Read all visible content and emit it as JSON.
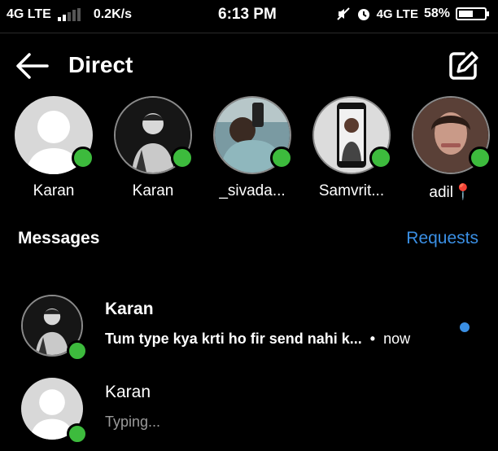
{
  "status_bar": {
    "network": "4G LTE",
    "speed": "0.2K/s",
    "time": "6:13 PM",
    "network_right": "4G LTE",
    "battery_percent": "58%",
    "battery_level": 0.58,
    "icons": [
      "signal-icon",
      "mute-icon",
      "alarm-icon",
      "battery-icon"
    ]
  },
  "header": {
    "title": "Direct",
    "back_icon": "back-arrow-icon",
    "compose_icon": "compose-icon"
  },
  "stories": [
    {
      "name": "Karan",
      "avatar": "default",
      "online": true
    },
    {
      "name": "Karan",
      "avatar": "photo",
      "online": true
    },
    {
      "name": "_sivada...",
      "avatar": "photo",
      "online": true
    },
    {
      "name": "Samvrit...",
      "avatar": "photo",
      "online": true
    },
    {
      "name": "adil📍",
      "avatar": "photo",
      "online": true
    }
  ],
  "messages": {
    "heading": "Messages",
    "requests_label": "Requests",
    "threads": [
      {
        "name": "Karan",
        "preview": "Tum type kya krti ho fir send nahi k...",
        "separator": "•",
        "time": "now",
        "unread": true,
        "online": true
      },
      {
        "name": "Karan",
        "preview": "Typing...",
        "online": true
      }
    ]
  },
  "colors": {
    "background": "#000000",
    "accent": "#3a8fe4",
    "online": "#3dbb3d"
  }
}
